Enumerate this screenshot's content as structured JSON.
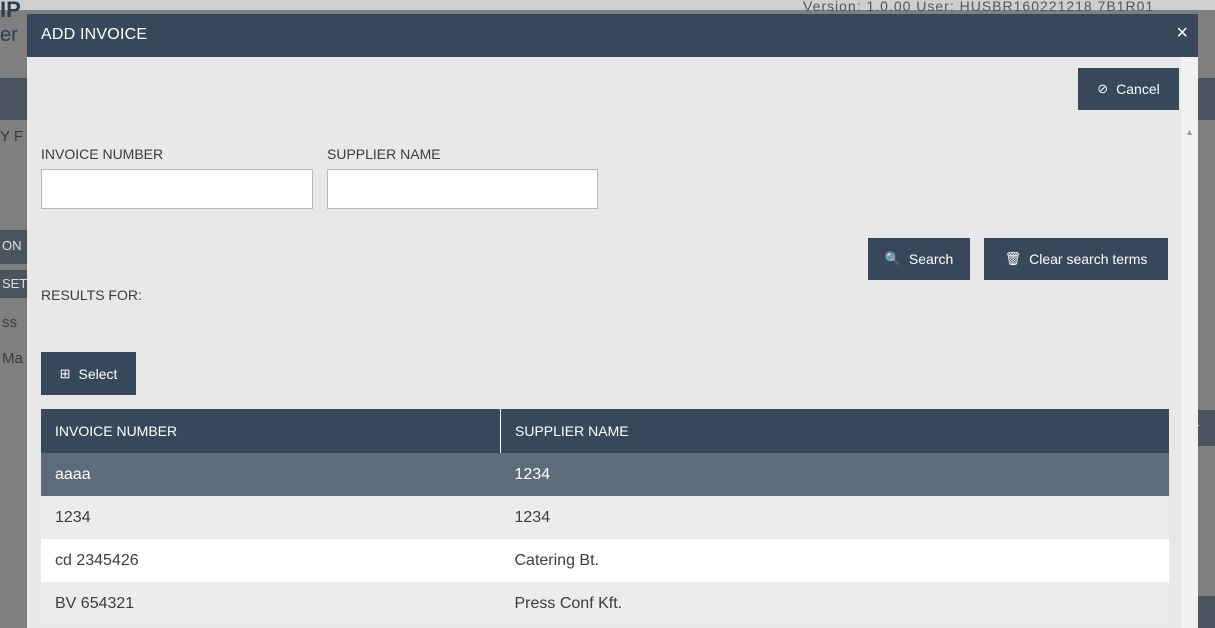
{
  "background": {
    "title_fragment": "IP",
    "sub_fragment": "er",
    "version_fragment": "Version: 1.0.00 User: HUSBR160221218 7B1R01",
    "left_fragments": [
      "Y F",
      "ON",
      "SET",
      "ss",
      "Ma"
    ],
    "right_fragment": "r"
  },
  "modal": {
    "title": "ADD INVOICE",
    "close_glyph": "×",
    "cancel": {
      "label": "Cancel",
      "icon": "⊘"
    },
    "fields": {
      "invoice_number": {
        "label": "INVOICE NUMBER",
        "value": "",
        "placeholder": ""
      },
      "supplier_name": {
        "label": "SUPPLIER NAME",
        "value": "",
        "placeholder": ""
      }
    },
    "search": {
      "label": "Search",
      "icon": "🔍"
    },
    "clear": {
      "label": "Clear search terms",
      "icon": "🗑"
    },
    "results_label": "RESULTS FOR:",
    "select": {
      "label": "Select",
      "icon": "⊞"
    },
    "table": {
      "columns": [
        "INVOICE NUMBER",
        "SUPPLIER NAME"
      ],
      "rows": [
        {
          "invoice": "aaaa",
          "supplier": "1234",
          "selected": true
        },
        {
          "invoice": "1234",
          "supplier": "1234",
          "selected": false
        },
        {
          "invoice": "cd 2345426",
          "supplier": "Catering Bt.",
          "selected": false
        },
        {
          "invoice": "BV 654321",
          "supplier": "Press Conf Kft.",
          "selected": false
        }
      ]
    }
  },
  "colors": {
    "header_bg": "#37485b",
    "selected_row_bg": "#5e6b7b",
    "modal_bg": "#e8e8e8"
  }
}
